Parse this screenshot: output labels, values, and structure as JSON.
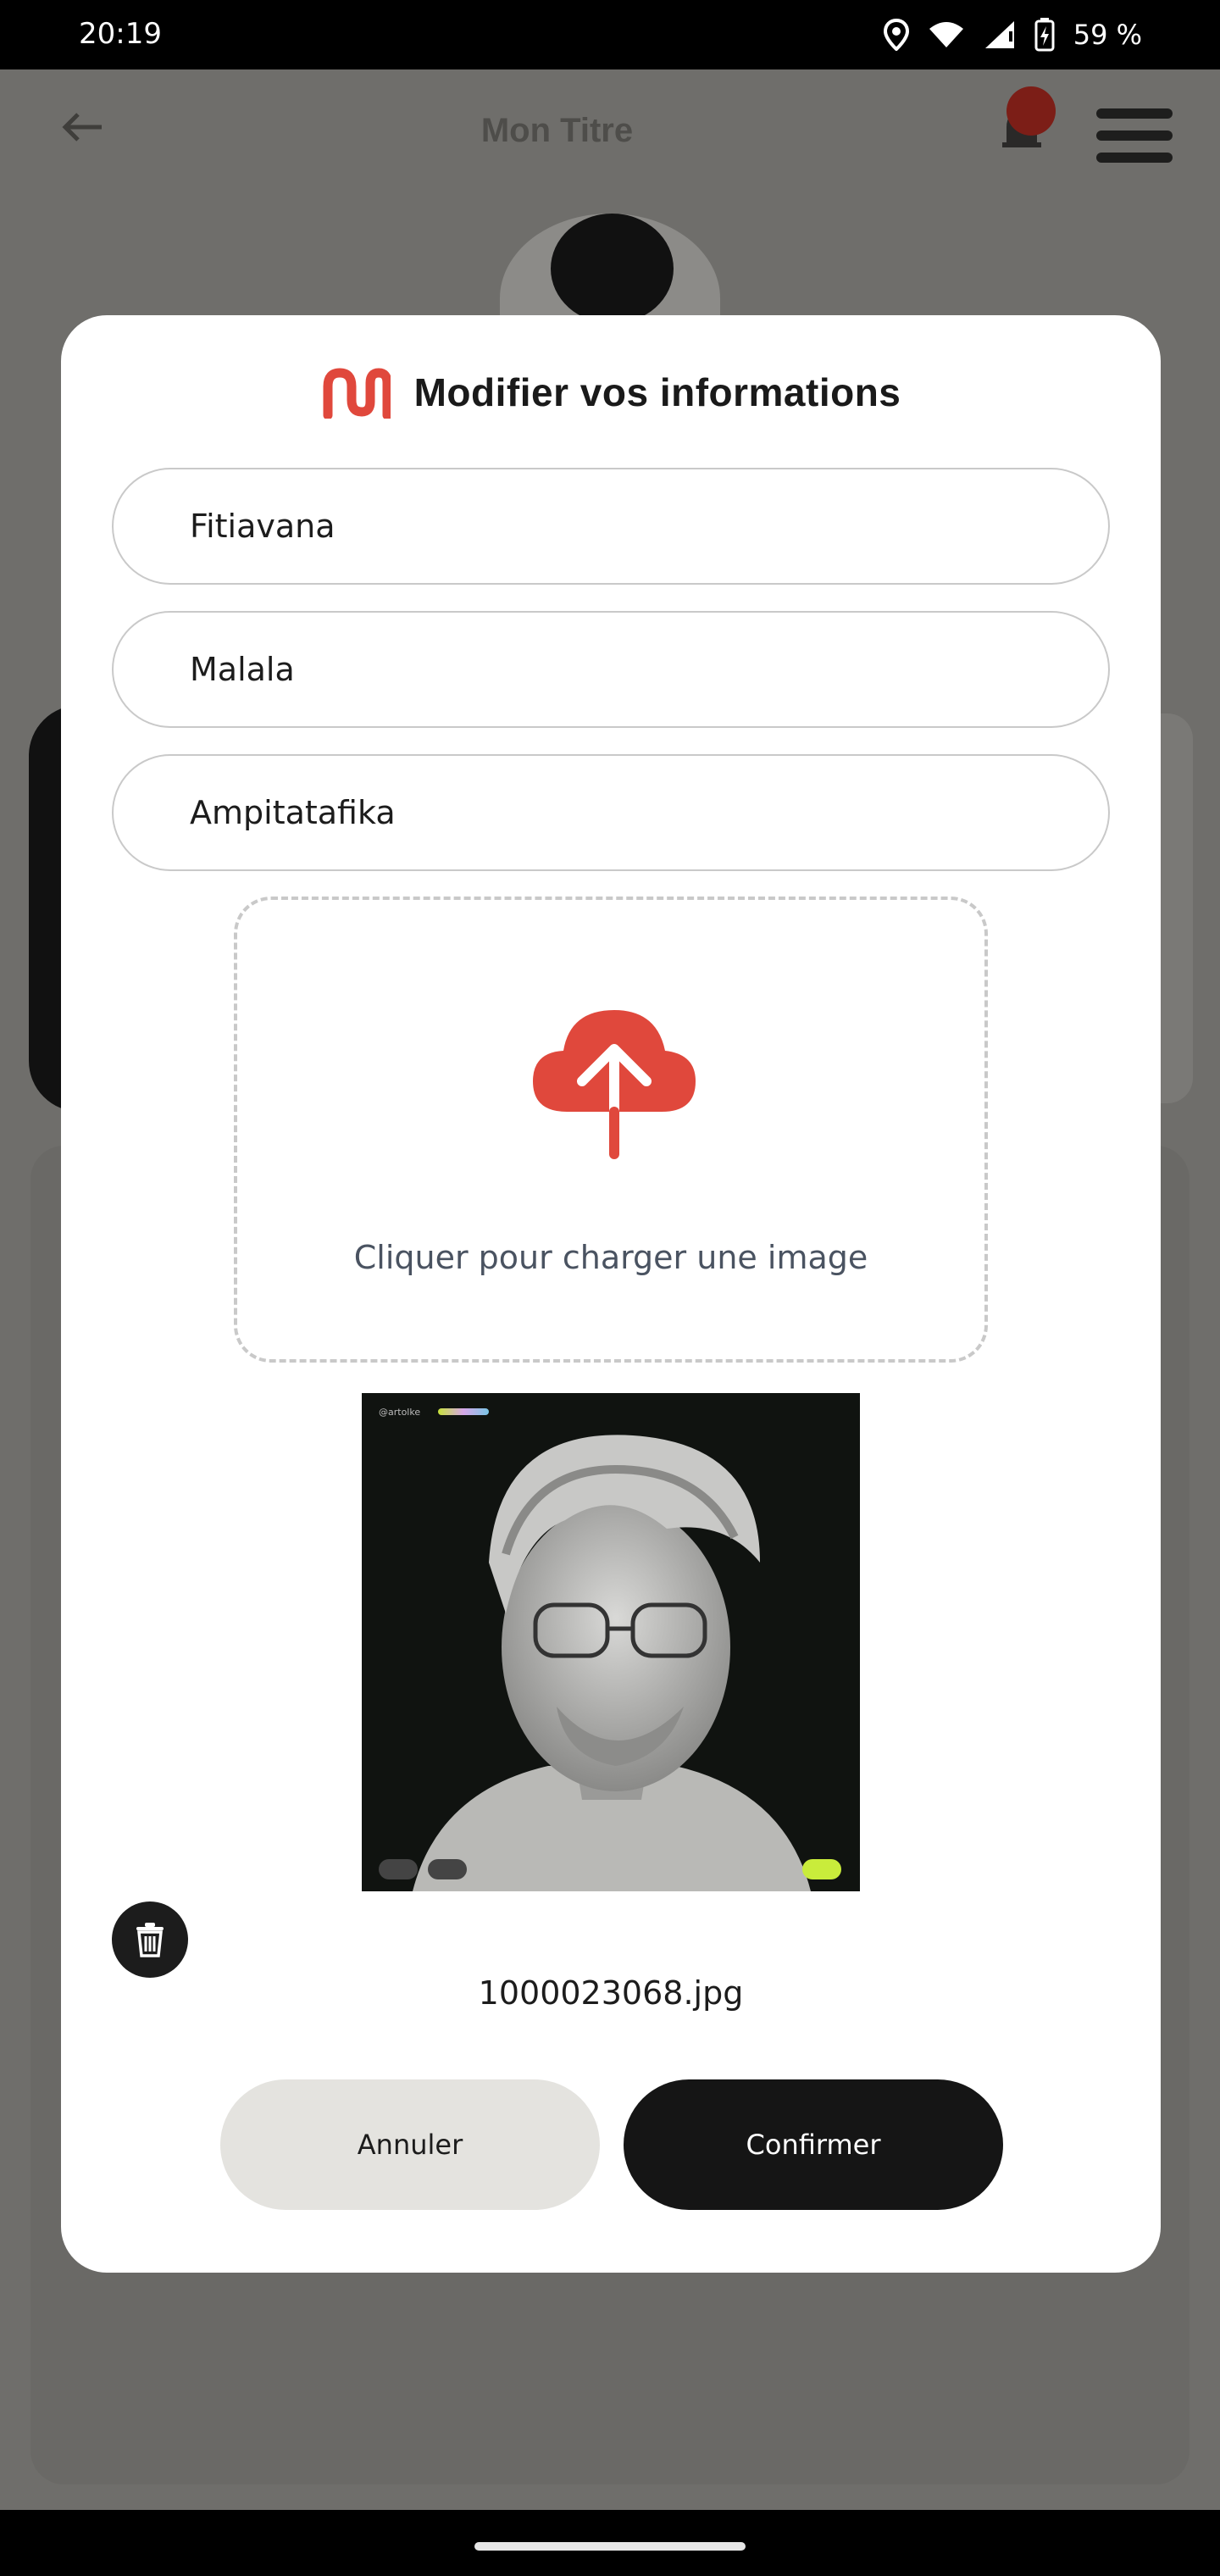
{
  "status_bar": {
    "time": "20:19",
    "battery_percent": "59 %",
    "icons": [
      "location-icon",
      "wifi-icon",
      "signal-icon",
      "battery-charging-icon"
    ]
  },
  "background_app": {
    "title": "Mon Titre",
    "icons": [
      "back-arrow-icon",
      "bell-icon",
      "menu-icon"
    ]
  },
  "modal": {
    "title": "Modifier vos informations",
    "logo_icon": "brand-logo-icon",
    "fields": [
      {
        "value": "Fitiavana"
      },
      {
        "value": "Malala"
      },
      {
        "value": "Ampitatafika"
      }
    ],
    "upload": {
      "icon": "cloud-upload-icon",
      "label": "Cliquer pour charger une image"
    },
    "preview": {
      "filename": "1000023068.jpg",
      "overlay_tag": "@artolke"
    },
    "buttons": {
      "cancel_label": "Annuler",
      "confirm_label": "Confirmer"
    }
  },
  "colors": {
    "accent": "#e0483c",
    "dark": "#151515",
    "cancel_bg": "#e4e3df",
    "overlay": "#6f6e6b"
  }
}
